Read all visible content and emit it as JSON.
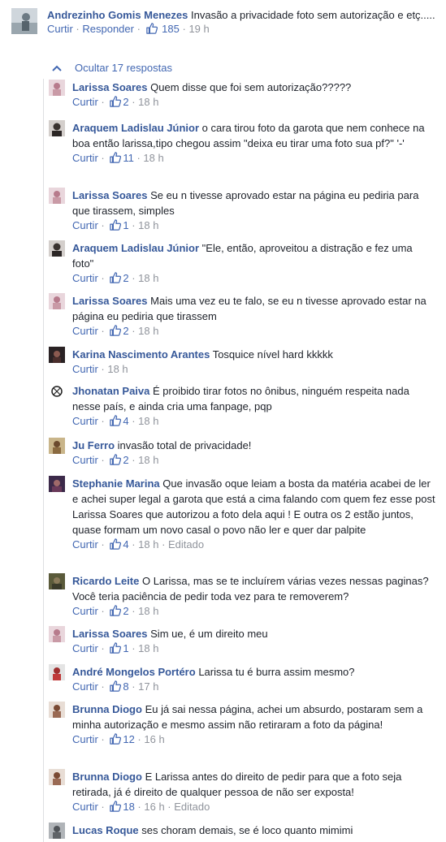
{
  "top_comment": {
    "author": "Andrezinho Gomis Menezes",
    "text": "Invasão a privacidade foto sem autorização e etç.....",
    "like_label": "Curtir",
    "reply_label": "Responder",
    "likes": "185",
    "time": "19 h"
  },
  "hide_replies_label": "Ocultar 17 respostas",
  "like_label": "Curtir",
  "edited_label": "Editado",
  "colors": {
    "link": "#365899",
    "action": "#4267b2",
    "meta": "#90949c"
  },
  "replies": [
    {
      "author": "Larissa Soares",
      "text": "Quem disse que foi sem autorização?????",
      "likes": "2",
      "time": "18 h",
      "avatar": "larissa"
    },
    {
      "author": "Araquem Ladislau Júnior",
      "text": "o cara tirou foto da garota que nem conhece na boa então larissa,tipo chegou assim \"deixa eu tirar uma foto sua pf?\" '-'",
      "likes": "11",
      "time": "18 h",
      "avatar": "araquem"
    },
    {
      "author": "Larissa Soares",
      "text": "Se eu n tivesse aprovado estar na página eu pediria para que tirassem, simples",
      "likes": "1",
      "time": "18 h",
      "avatar": "larissa"
    },
    {
      "author": "Araquem Ladislau Júnior",
      "text": "\"Ele, então, aproveitou a distração e fez uma foto\"",
      "likes": "2",
      "time": "18 h",
      "avatar": "araquem"
    },
    {
      "author": "Larissa Soares",
      "text": "Mais uma vez eu te falo, se eu n tivesse aprovado estar na página eu pediria que tirassem",
      "likes": "2",
      "time": "18 h",
      "avatar": "larissa"
    },
    {
      "author": "Karina Nascimento Arantes",
      "text": "Tosquice nível hard kkkkk",
      "likes": "",
      "time": "18 h",
      "avatar": "karina"
    },
    {
      "author": "Jhonatan Paiva",
      "text": "É proibido tirar fotos no ônibus, ninguém respeita nada nesse país, e ainda cria uma fanpage, pqp",
      "likes": "4",
      "time": "18 h",
      "avatar": "jhonatan"
    },
    {
      "author": "Ju Ferro",
      "text": "invasão total de privacidade!",
      "likes": "2",
      "time": "18 h",
      "avatar": "ju"
    },
    {
      "author": "Stephanie Marina",
      "text": "Que invasão oque leiam a bosta da matéria acabei de ler e achei super legal a garota que está a cima falando com quem fez esse post Larissa Soares que autorizou a foto dela aqui ! E outra os 2 estão juntos, quase formam um novo casal o povo não ler e quer dar palpite",
      "likes": "4",
      "time": "18 h",
      "edited": true,
      "avatar": "stephanie"
    },
    {
      "author": "Ricardo Leite",
      "text": "O Larissa, mas se te incluírem várias vezes nessas paginas? Você teria paciência de pedir toda vez para te removerem?",
      "likes": "2",
      "time": "18 h",
      "avatar": "ricardo"
    },
    {
      "author": "Larissa Soares",
      "text": "Sim ue, é um direito meu",
      "likes": "1",
      "time": "18 h",
      "avatar": "larissa"
    },
    {
      "author": "André Mongelos Portéro",
      "text": "Larissa tu é burra assim mesmo?",
      "likes": "8",
      "time": "17 h",
      "avatar": "andre"
    },
    {
      "author": "Brunna Diogo",
      "text": "Eu já sai nessa página, achei um absurdo, postaram sem a minha autorização e mesmo assim não retiraram a foto da página!",
      "likes": "12",
      "time": "16 h",
      "avatar": "brunna"
    },
    {
      "author": "Brunna Diogo",
      "text": "E Larissa antes do direito de pedir para que a foto seja retirada, já é direito de qualquer pessoa de não ser exposta!",
      "likes": "18",
      "time": "16 h",
      "edited": true,
      "avatar": "brunna"
    },
    {
      "author": "Lucas Roque",
      "text": "ses choram demais, se é loco quanto mimimi",
      "likes": "",
      "time": "",
      "avatar": "lucas"
    }
  ]
}
